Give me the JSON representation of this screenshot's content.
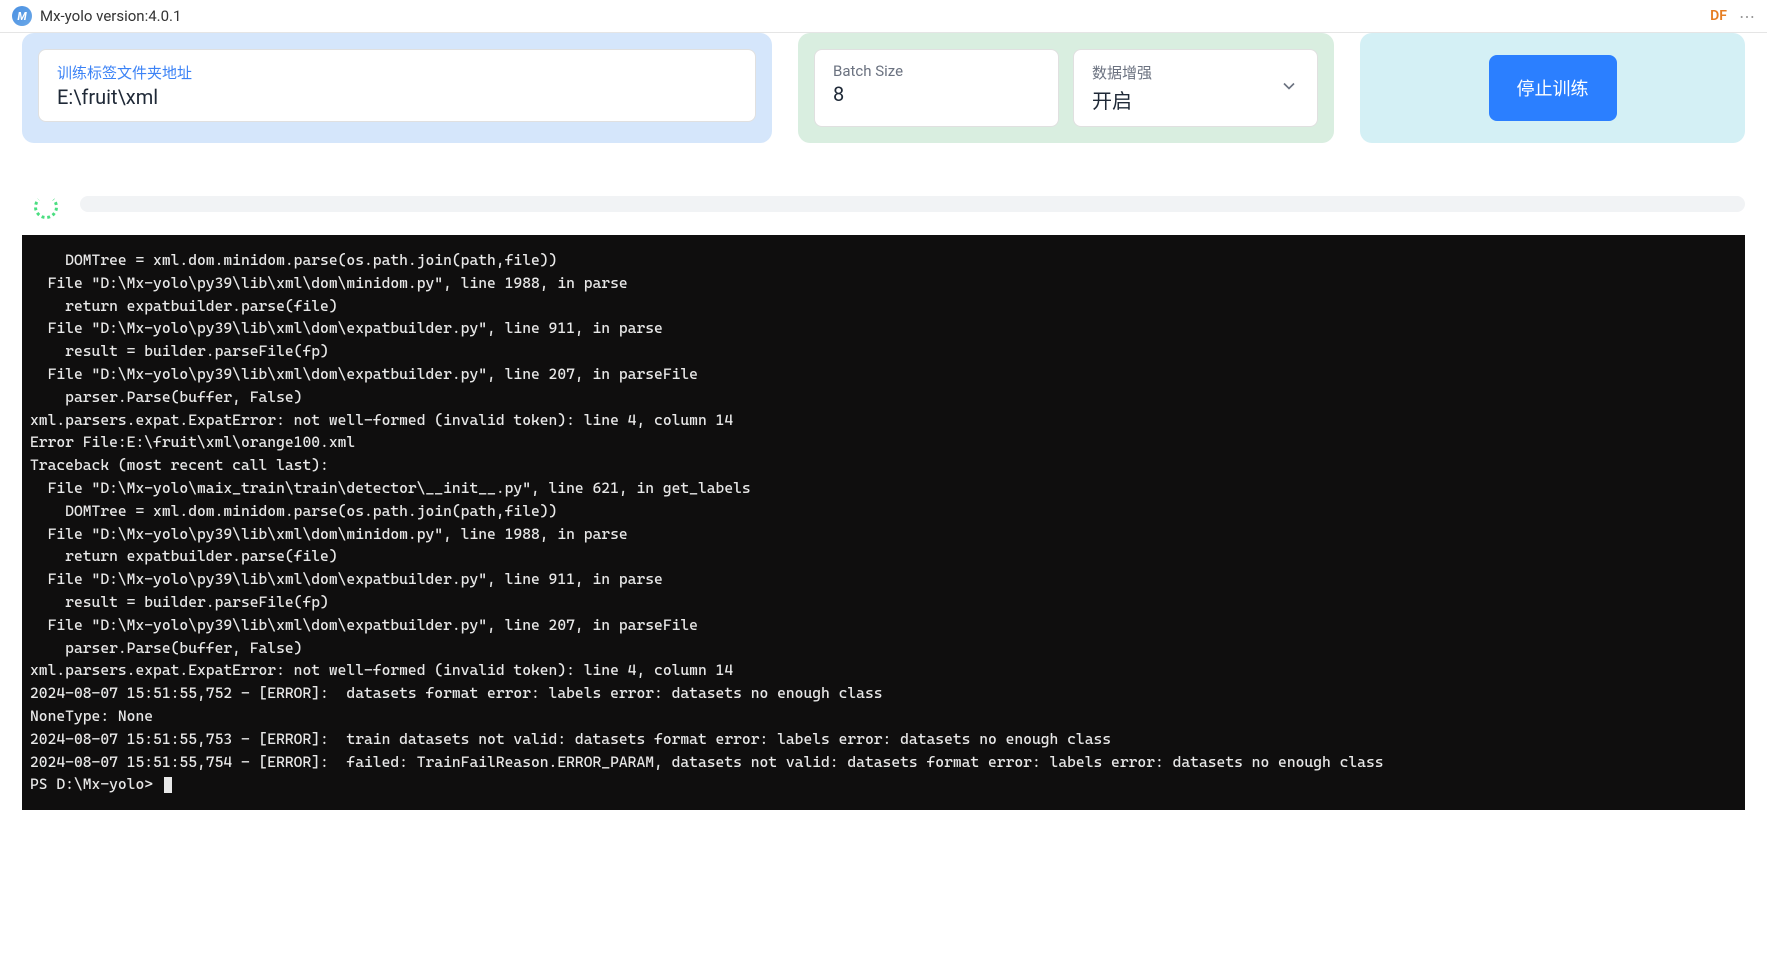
{
  "titlebar": {
    "app_icon_letter": "M",
    "app_title": "Mx-yolo version:4.0.1",
    "user_badge": "DF"
  },
  "panels": {
    "label_input": {
      "label": "训练标签文件夹地址",
      "value": "E:\\fruit\\xml"
    },
    "batch_size": {
      "label": "Batch Size",
      "value": "8"
    },
    "augmentation": {
      "label": "数据增强",
      "value": "开启"
    },
    "stop_button": "停止训练"
  },
  "terminal": {
    "lines": [
      "    DOMTree = xml.dom.minidom.parse(os.path.join(path,file))",
      "  File \"D:\\Mx-yolo\\py39\\lib\\xml\\dom\\minidom.py\", line 1988, in parse",
      "    return expatbuilder.parse(file)",
      "  File \"D:\\Mx-yolo\\py39\\lib\\xml\\dom\\expatbuilder.py\", line 911, in parse",
      "    result = builder.parseFile(fp)",
      "  File \"D:\\Mx-yolo\\py39\\lib\\xml\\dom\\expatbuilder.py\", line 207, in parseFile",
      "    parser.Parse(buffer, False)",
      "xml.parsers.expat.ExpatError: not well-formed (invalid token): line 4, column 14",
      "Error File:E:\\fruit\\xml\\orange100.xml",
      "Traceback (most recent call last):",
      "  File \"D:\\Mx-yolo\\maix_train\\train\\detector\\__init__.py\", line 621, in get_labels",
      "    DOMTree = xml.dom.minidom.parse(os.path.join(path,file))",
      "  File \"D:\\Mx-yolo\\py39\\lib\\xml\\dom\\minidom.py\", line 1988, in parse",
      "    return expatbuilder.parse(file)",
      "  File \"D:\\Mx-yolo\\py39\\lib\\xml\\dom\\expatbuilder.py\", line 911, in parse",
      "    result = builder.parseFile(fp)",
      "  File \"D:\\Mx-yolo\\py39\\lib\\xml\\dom\\expatbuilder.py\", line 207, in parseFile",
      "    parser.Parse(buffer, False)",
      "xml.parsers.expat.ExpatError: not well-formed (invalid token): line 4, column 14",
      "2024-08-07 15:51:55,752 - [ERROR]:  datasets format error: labels error: datasets no enough class",
      "NoneType: None",
      "2024-08-07 15:51:55,753 - [ERROR]:  train datasets not valid: datasets format error: labels error: datasets no enough class",
      "2024-08-07 15:51:55,754 - [ERROR]:  failed: TrainFailReason.ERROR_PARAM, datasets not valid: datasets format error: labels error: datasets no enough class"
    ],
    "prompt": "PS D:\\Mx-yolo> "
  }
}
